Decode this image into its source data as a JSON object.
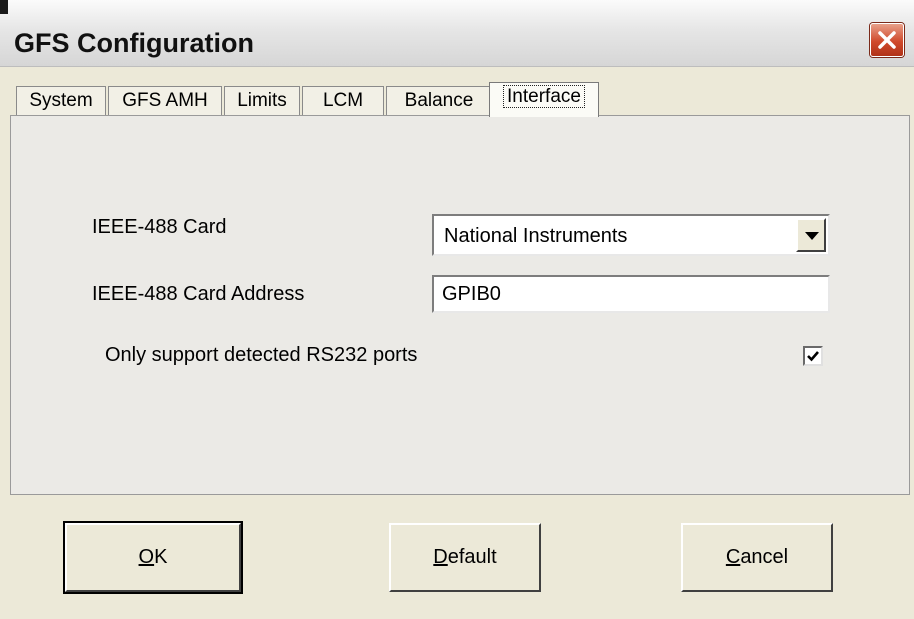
{
  "window": {
    "title": "GFS Configuration",
    "close_icon": "close-icon",
    "close_color": "#d04a2c"
  },
  "tabs": [
    {
      "label": "System"
    },
    {
      "label": "GFS AMH"
    },
    {
      "label": "Limits"
    },
    {
      "label": "LCM"
    },
    {
      "label": "Balance"
    },
    {
      "label": "Interface",
      "active": true
    }
  ],
  "form": {
    "card_label": "IEEE-488 Card",
    "card_value": "National Instruments",
    "address_label": "IEEE-488 Card Address",
    "address_value": "GPIB0",
    "rs232_label": "Only support detected RS232 ports",
    "rs232_checked": true
  },
  "buttons": {
    "ok": {
      "mnemonic": "O",
      "rest": "K"
    },
    "default": {
      "mnemonic": "D",
      "rest": "efault"
    },
    "cancel": {
      "mnemonic": "C",
      "rest": "ancel"
    }
  }
}
